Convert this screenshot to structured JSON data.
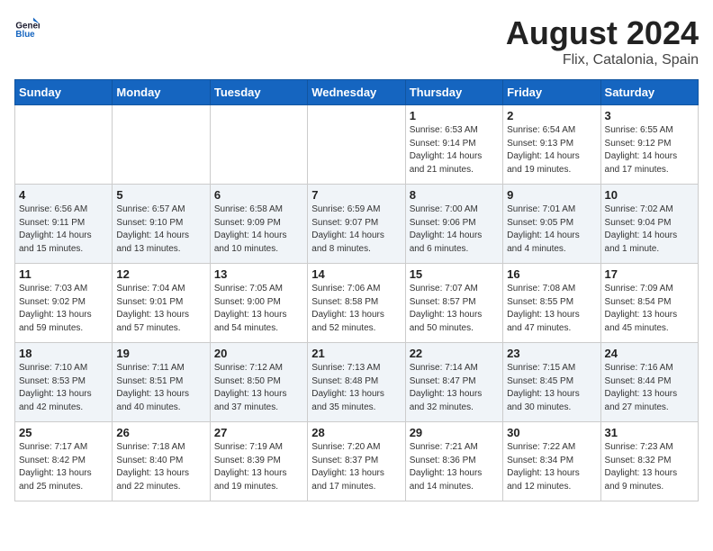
{
  "header": {
    "logo_line1": "General",
    "logo_line2": "Blue",
    "month_year": "August 2024",
    "location": "Flix, Catalonia, Spain"
  },
  "weekdays": [
    "Sunday",
    "Monday",
    "Tuesday",
    "Wednesday",
    "Thursday",
    "Friday",
    "Saturday"
  ],
  "weeks": [
    [
      {
        "day": "",
        "info": ""
      },
      {
        "day": "",
        "info": ""
      },
      {
        "day": "",
        "info": ""
      },
      {
        "day": "",
        "info": ""
      },
      {
        "day": "1",
        "info": "Sunrise: 6:53 AM\nSunset: 9:14 PM\nDaylight: 14 hours\nand 21 minutes."
      },
      {
        "day": "2",
        "info": "Sunrise: 6:54 AM\nSunset: 9:13 PM\nDaylight: 14 hours\nand 19 minutes."
      },
      {
        "day": "3",
        "info": "Sunrise: 6:55 AM\nSunset: 9:12 PM\nDaylight: 14 hours\nand 17 minutes."
      }
    ],
    [
      {
        "day": "4",
        "info": "Sunrise: 6:56 AM\nSunset: 9:11 PM\nDaylight: 14 hours\nand 15 minutes."
      },
      {
        "day": "5",
        "info": "Sunrise: 6:57 AM\nSunset: 9:10 PM\nDaylight: 14 hours\nand 13 minutes."
      },
      {
        "day": "6",
        "info": "Sunrise: 6:58 AM\nSunset: 9:09 PM\nDaylight: 14 hours\nand 10 minutes."
      },
      {
        "day": "7",
        "info": "Sunrise: 6:59 AM\nSunset: 9:07 PM\nDaylight: 14 hours\nand 8 minutes."
      },
      {
        "day": "8",
        "info": "Sunrise: 7:00 AM\nSunset: 9:06 PM\nDaylight: 14 hours\nand 6 minutes."
      },
      {
        "day": "9",
        "info": "Sunrise: 7:01 AM\nSunset: 9:05 PM\nDaylight: 14 hours\nand 4 minutes."
      },
      {
        "day": "10",
        "info": "Sunrise: 7:02 AM\nSunset: 9:04 PM\nDaylight: 14 hours\nand 1 minute."
      }
    ],
    [
      {
        "day": "11",
        "info": "Sunrise: 7:03 AM\nSunset: 9:02 PM\nDaylight: 13 hours\nand 59 minutes."
      },
      {
        "day": "12",
        "info": "Sunrise: 7:04 AM\nSunset: 9:01 PM\nDaylight: 13 hours\nand 57 minutes."
      },
      {
        "day": "13",
        "info": "Sunrise: 7:05 AM\nSunset: 9:00 PM\nDaylight: 13 hours\nand 54 minutes."
      },
      {
        "day": "14",
        "info": "Sunrise: 7:06 AM\nSunset: 8:58 PM\nDaylight: 13 hours\nand 52 minutes."
      },
      {
        "day": "15",
        "info": "Sunrise: 7:07 AM\nSunset: 8:57 PM\nDaylight: 13 hours\nand 50 minutes."
      },
      {
        "day": "16",
        "info": "Sunrise: 7:08 AM\nSunset: 8:55 PM\nDaylight: 13 hours\nand 47 minutes."
      },
      {
        "day": "17",
        "info": "Sunrise: 7:09 AM\nSunset: 8:54 PM\nDaylight: 13 hours\nand 45 minutes."
      }
    ],
    [
      {
        "day": "18",
        "info": "Sunrise: 7:10 AM\nSunset: 8:53 PM\nDaylight: 13 hours\nand 42 minutes."
      },
      {
        "day": "19",
        "info": "Sunrise: 7:11 AM\nSunset: 8:51 PM\nDaylight: 13 hours\nand 40 minutes."
      },
      {
        "day": "20",
        "info": "Sunrise: 7:12 AM\nSunset: 8:50 PM\nDaylight: 13 hours\nand 37 minutes."
      },
      {
        "day": "21",
        "info": "Sunrise: 7:13 AM\nSunset: 8:48 PM\nDaylight: 13 hours\nand 35 minutes."
      },
      {
        "day": "22",
        "info": "Sunrise: 7:14 AM\nSunset: 8:47 PM\nDaylight: 13 hours\nand 32 minutes."
      },
      {
        "day": "23",
        "info": "Sunrise: 7:15 AM\nSunset: 8:45 PM\nDaylight: 13 hours\nand 30 minutes."
      },
      {
        "day": "24",
        "info": "Sunrise: 7:16 AM\nSunset: 8:44 PM\nDaylight: 13 hours\nand 27 minutes."
      }
    ],
    [
      {
        "day": "25",
        "info": "Sunrise: 7:17 AM\nSunset: 8:42 PM\nDaylight: 13 hours\nand 25 minutes."
      },
      {
        "day": "26",
        "info": "Sunrise: 7:18 AM\nSunset: 8:40 PM\nDaylight: 13 hours\nand 22 minutes."
      },
      {
        "day": "27",
        "info": "Sunrise: 7:19 AM\nSunset: 8:39 PM\nDaylight: 13 hours\nand 19 minutes."
      },
      {
        "day": "28",
        "info": "Sunrise: 7:20 AM\nSunset: 8:37 PM\nDaylight: 13 hours\nand 17 minutes."
      },
      {
        "day": "29",
        "info": "Sunrise: 7:21 AM\nSunset: 8:36 PM\nDaylight: 13 hours\nand 14 minutes."
      },
      {
        "day": "30",
        "info": "Sunrise: 7:22 AM\nSunset: 8:34 PM\nDaylight: 13 hours\nand 12 minutes."
      },
      {
        "day": "31",
        "info": "Sunrise: 7:23 AM\nSunset: 8:32 PM\nDaylight: 13 hours\nand 9 minutes."
      }
    ]
  ]
}
